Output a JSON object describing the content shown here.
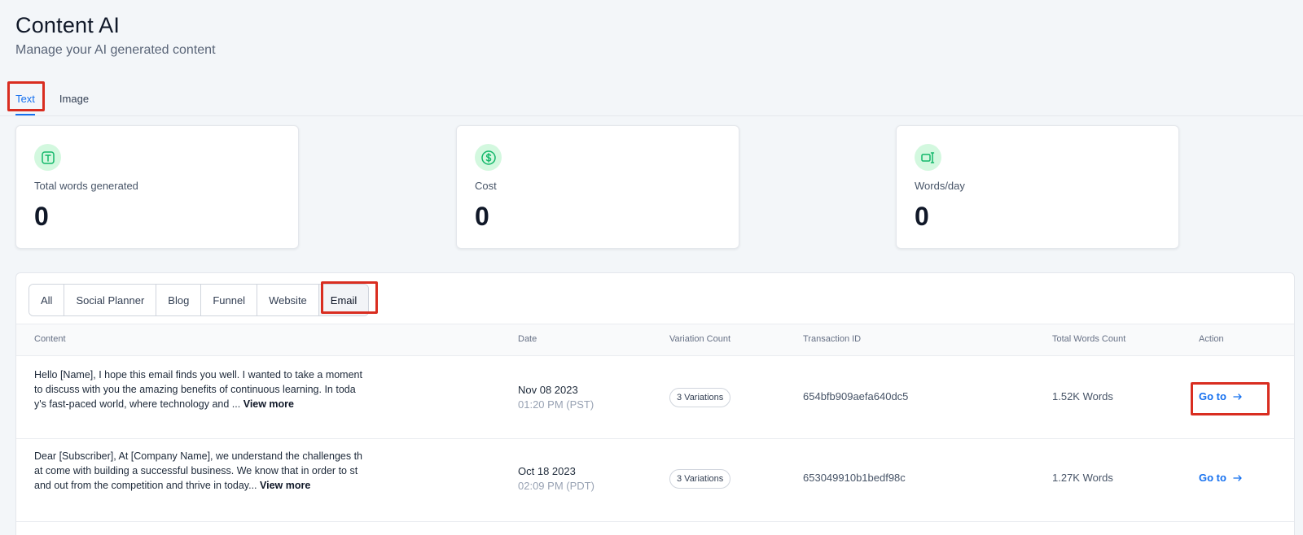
{
  "header": {
    "title": "Content AI",
    "subtitle": "Manage your AI generated content"
  },
  "tabs": [
    {
      "label": "Text",
      "active": true
    },
    {
      "label": "Image",
      "active": false
    }
  ],
  "stats": [
    {
      "icon": "text-t-icon",
      "label": "Total words generated",
      "value": "0"
    },
    {
      "icon": "dollar-circle-icon",
      "label": "Cost",
      "value": "0"
    },
    {
      "icon": "words-per-day-icon",
      "label": "Words/day",
      "value": "0"
    }
  ],
  "filters": [
    {
      "label": "All"
    },
    {
      "label": "Social Planner"
    },
    {
      "label": "Blog"
    },
    {
      "label": "Funnel"
    },
    {
      "label": "Website"
    },
    {
      "label": "Email",
      "active": true
    }
  ],
  "table": {
    "headers": {
      "content": "Content",
      "date": "Date",
      "variation_count": "Variation Count",
      "transaction_id": "Transaction ID",
      "total_words": "Total Words Count",
      "action": "Action"
    },
    "rows": [
      {
        "content": "Hello [Name], I hope this email finds you well. I wanted to take a moment to discuss with you the amazing benefits of continuous learning. In today's fast-paced world, where technology and ... ",
        "view_more": "View more",
        "date": "Nov 08 2023",
        "time": "01:20 PM (PST)",
        "variations": "3 Variations",
        "transaction_id": "654bfb909aefa640dc5",
        "words": "1.52K Words",
        "action": "Go to"
      },
      {
        "content": "Dear [Subscriber], At [Company Name], we understand the challenges that come with building a successful business. We know that in order to stand out from the competition and thrive in today... ",
        "view_more": "View more",
        "date": "Oct 18 2023",
        "time": "02:09 PM (PDT)",
        "variations": "3 Variations",
        "transaction_id": "653049910b1bedf98c",
        "words": "1.27K Words",
        "action": "Go to"
      }
    ]
  },
  "colors": {
    "accent": "#1570ef",
    "icon_bg": "#d3f8df",
    "icon_fg": "#12b76a",
    "highlight": "#d92d20"
  }
}
